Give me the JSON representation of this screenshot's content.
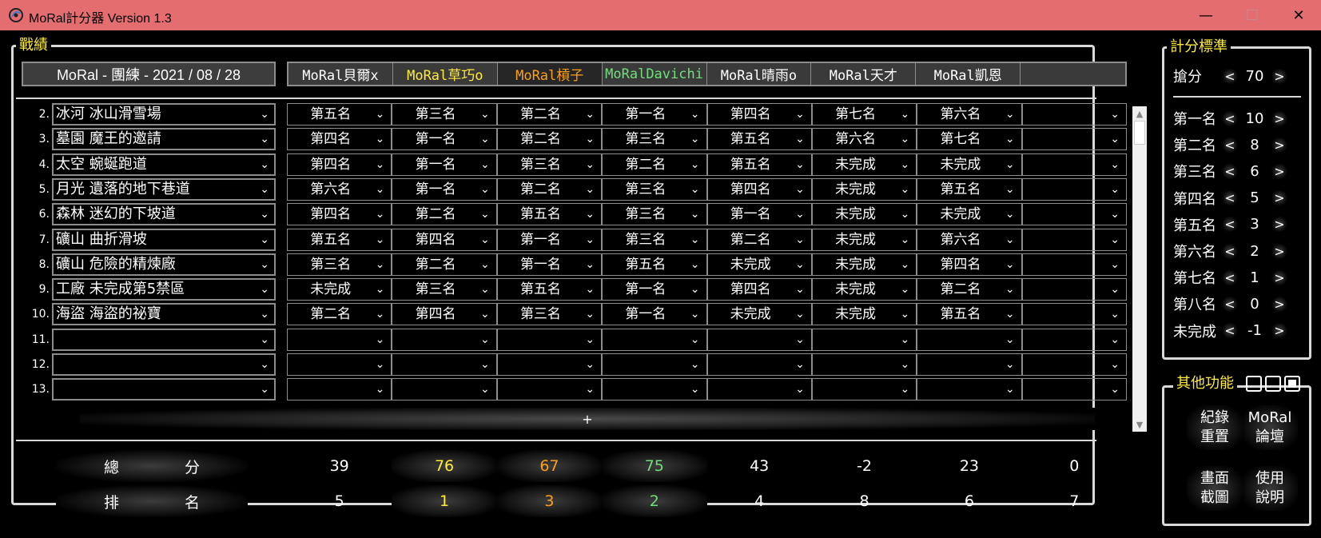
{
  "window": {
    "title": "MoRal計分器 Version 1.3",
    "min": "—",
    "max": "☐",
    "close": "✕"
  },
  "record_group": {
    "title": "戰績",
    "event": "MoRal - 團練 - 2021 / 08 / 28",
    "add_row": "+"
  },
  "players": [
    {
      "name": "MoRal貝爾x",
      "color": "#ffffff"
    },
    {
      "name": "MoRal草巧o",
      "color": "#ffeb3b"
    },
    {
      "name": "MoRal槓子",
      "color": "#ff9f1c"
    },
    {
      "name": "MoRalDavichi",
      "color": "#6fe07a"
    },
    {
      "name": "MoRal晴雨o",
      "color": "#ffffff"
    },
    {
      "name": "MoRal天才",
      "color": "#ffffff"
    },
    {
      "name": "MoRal凱恩",
      "color": "#ffffff"
    },
    {
      "name": "",
      "color": "#ffffff"
    }
  ],
  "rows": [
    {
      "num": "2.",
      "stage": "冰河 冰山滑雪場",
      "results": [
        "第五名",
        "第三名",
        "第二名",
        "第一名",
        "第四名",
        "第七名",
        "第六名",
        ""
      ]
    },
    {
      "num": "3.",
      "stage": "墓園 魔王的邀請",
      "results": [
        "第四名",
        "第一名",
        "第二名",
        "第三名",
        "第五名",
        "第六名",
        "第七名",
        ""
      ]
    },
    {
      "num": "4.",
      "stage": "太空 蜿蜒跑道",
      "results": [
        "第四名",
        "第一名",
        "第三名",
        "第二名",
        "第五名",
        "未完成",
        "未完成",
        ""
      ]
    },
    {
      "num": "5.",
      "stage": "月光 遺落的地下巷道",
      "results": [
        "第六名",
        "第一名",
        "第二名",
        "第三名",
        "第四名",
        "未完成",
        "第五名",
        ""
      ]
    },
    {
      "num": "6.",
      "stage": "森林 迷幻的下坡道",
      "results": [
        "第四名",
        "第二名",
        "第五名",
        "第三名",
        "第一名",
        "未完成",
        "未完成",
        ""
      ]
    },
    {
      "num": "7.",
      "stage": "礦山 曲折滑坡",
      "results": [
        "第五名",
        "第四名",
        "第一名",
        "第三名",
        "第二名",
        "未完成",
        "第六名",
        ""
      ]
    },
    {
      "num": "8.",
      "stage": "礦山 危險的精煉廠",
      "results": [
        "第三名",
        "第二名",
        "第一名",
        "第五名",
        "未完成",
        "未完成",
        "第四名",
        ""
      ]
    },
    {
      "num": "9.",
      "stage": "工廠 未完成第5禁區",
      "results": [
        "未完成",
        "第三名",
        "第五名",
        "第一名",
        "第四名",
        "未完成",
        "第二名",
        ""
      ]
    },
    {
      "num": "10.",
      "stage": "海盜 海盜的祕寶",
      "results": [
        "第二名",
        "第四名",
        "第三名",
        "第一名",
        "未完成",
        "未完成",
        "第五名",
        ""
      ]
    },
    {
      "num": "11.",
      "stage": "",
      "results": [
        "",
        "",
        "",
        "",
        "",
        "",
        "",
        ""
      ]
    },
    {
      "num": "12.",
      "stage": "",
      "results": [
        "",
        "",
        "",
        "",
        "",
        "",
        "",
        ""
      ]
    },
    {
      "num": "13.",
      "stage": "",
      "results": [
        "",
        "",
        "",
        "",
        "",
        "",
        "",
        ""
      ]
    }
  ],
  "totals": {
    "score_label_a": "總",
    "score_label_b": "分",
    "rank_label_a": "排",
    "rank_label_b": "名",
    "scores": [
      "39",
      "76",
      "67",
      "75",
      "43",
      "-2",
      "23",
      "0"
    ],
    "ranks": [
      "5",
      "1",
      "3",
      "2",
      "4",
      "8",
      "6",
      "7"
    ]
  },
  "score_panel": {
    "title": "計分標準",
    "steal": {
      "label": "搶分",
      "value": "70"
    },
    "items": [
      {
        "label": "第一名",
        "value": "10"
      },
      {
        "label": "第二名",
        "value": "8"
      },
      {
        "label": "第三名",
        "value": "6"
      },
      {
        "label": "第四名",
        "value": "5"
      },
      {
        "label": "第五名",
        "value": "3"
      },
      {
        "label": "第六名",
        "value": "2"
      },
      {
        "label": "第七名",
        "value": "1"
      },
      {
        "label": "第八名",
        "value": "0"
      },
      {
        "label": "未完成",
        "value": "-1"
      }
    ],
    "left_arrow": "<",
    "right_arrow": ">"
  },
  "functions": {
    "title": "其他功能",
    "reset": [
      "紀錄",
      "重置"
    ],
    "forum": [
      "MoRal",
      "論壇"
    ],
    "screenshot": [
      "畫面",
      "截圖"
    ],
    "manual": [
      "使用",
      "說明"
    ]
  },
  "chevron": "⌄"
}
